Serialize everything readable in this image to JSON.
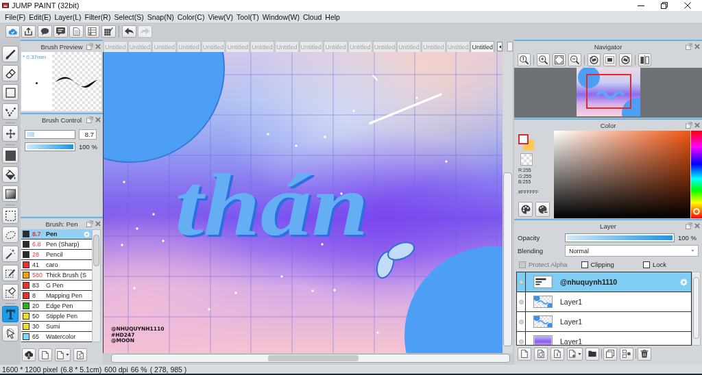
{
  "window": {
    "title": "JUMP PAINT (32bit)"
  },
  "menu": [
    "File(F)",
    "Edit(E)",
    "Layer(L)",
    "Filter(R)",
    "Select(S)",
    "Snap(N)",
    "Color(C)",
    "View(V)",
    "Tool(T)",
    "Window(W)",
    "Cloud",
    "Help"
  ],
  "toolbar_groups": [
    [
      {
        "kind": "cloud",
        "disabled": false
      },
      {
        "kind": "upload",
        "disabled": false
      },
      {
        "kind": "speech",
        "disabled": false
      },
      {
        "kind": "message",
        "disabled": false
      },
      {
        "kind": "document",
        "disabled": false
      },
      {
        "kind": "list",
        "disabled": false
      },
      {
        "kind": "grid_edit",
        "disabled": false
      }
    ],
    [
      {
        "kind": "undo",
        "disabled": false
      },
      {
        "kind": "redo",
        "disabled": true
      }
    ]
  ],
  "tool_groups": [
    [
      {
        "kind": "brush",
        "selected": false
      },
      {
        "kind": "eraser",
        "selected": false
      },
      {
        "kind": "shape",
        "selected": false
      },
      {
        "kind": "polyline",
        "selected": false
      }
    ],
    [
      {
        "kind": "move",
        "selected": false
      }
    ],
    [
      {
        "kind": "fill",
        "selected": false
      },
      {
        "kind": "bucket",
        "selected": false
      },
      {
        "kind": "gradient",
        "selected": false
      }
    ],
    [
      {
        "kind": "select",
        "selected": false
      },
      {
        "kind": "lasso",
        "selected": false
      },
      {
        "kind": "wand",
        "selected": false
      },
      {
        "kind": "select_pen",
        "selected": false
      },
      {
        "kind": "select_eraser",
        "selected": false
      }
    ],
    [
      {
        "kind": "text",
        "selected": true
      },
      {
        "kind": "operation",
        "selected": false
      }
    ]
  ],
  "brush_preview": {
    "title": "Brush Preview",
    "size_label": "* 0.37mm"
  },
  "brush_control": {
    "title": "Brush Control",
    "size": {
      "level": 0.16,
      "value": "8.7"
    },
    "opacity": {
      "level": 1,
      "reading": "100 %"
    }
  },
  "brush_list": {
    "title": "Brush: Pen",
    "items": [
      {
        "color": "#2b2b2b",
        "size": "8.7",
        "size_highlighted": true,
        "name": "Pen",
        "selected": true
      },
      {
        "color": "#2b2b2b",
        "size": "6.8",
        "size_highlighted": true,
        "name": "Pen (Sharp)",
        "selected": false
      },
      {
        "color": "#2b2b2b",
        "size": "28",
        "size_highlighted": true,
        "name": "Pencil",
        "selected": false
      },
      {
        "color": "#e8322e",
        "size": "41",
        "size_highlighted": false,
        "name": "caro",
        "selected": false
      },
      {
        "color": "#f0a010",
        "size": "580",
        "size_highlighted": true,
        "name": "Thick Brush (S",
        "selected": false
      },
      {
        "color": "#e8322e",
        "size": "83",
        "size_highlighted": false,
        "name": "G Pen",
        "selected": false
      },
      {
        "color": "#e8322e",
        "size": "8",
        "size_highlighted": false,
        "name": "Mapping Pen",
        "selected": false
      },
      {
        "color": "#22b422",
        "size": "20",
        "size_highlighted": false,
        "name": "Edge Pen",
        "selected": false
      },
      {
        "color": "#ece024",
        "size": "50",
        "size_highlighted": false,
        "name": "Stipple Pen",
        "selected": false
      },
      {
        "color": "#ece024",
        "size": "30",
        "size_highlighted": false,
        "name": "Sumi",
        "selected": false
      },
      {
        "color": "#7cd8f8",
        "size": "65",
        "size_highlighted": false,
        "name": "Watercolor",
        "selected": false
      }
    ]
  },
  "tabs": [
    {
      "label": "Untitled",
      "selected": false
    },
    {
      "label": "Untitled",
      "selected": false
    },
    {
      "label": "Untitled",
      "selected": false
    },
    {
      "label": "Untitled",
      "selected": false
    },
    {
      "label": "Untitled",
      "selected": false
    },
    {
      "label": "Untitled",
      "selected": false
    },
    {
      "label": "Untitled",
      "selected": false
    },
    {
      "label": "Untitled",
      "selected": false
    },
    {
      "label": "Untitled",
      "selected": false
    },
    {
      "label": "Untitled",
      "selected": false
    },
    {
      "label": "Untitled",
      "selected": false
    },
    {
      "label": "Untitled",
      "selected": false
    },
    {
      "label": "Untitled",
      "selected": false
    },
    {
      "label": "Untitled",
      "selected": false
    },
    {
      "label": "Untitled",
      "selected": false
    },
    {
      "label": "Untitled",
      "selected": true
    }
  ],
  "canvas": {
    "lettering": "thán",
    "credits": [
      "@NHUQUYNH1110",
      "#HD247",
      "@MOON"
    ]
  },
  "navigator": {
    "title": "Navigator"
  },
  "color": {
    "title": "Color",
    "swatches": [
      {
        "kind": "foreground",
        "color": "#ffffff"
      },
      {
        "kind": "background",
        "color": "#ffc65a"
      }
    ],
    "channels": [
      "R:255",
      "G:255",
      "B:255"
    ],
    "hex": "#FFFFFF"
  },
  "layer_panel": {
    "title": "Layer",
    "opacity": {
      "label": "Opacity",
      "level": 1,
      "reading": "100 %"
    },
    "blending": {
      "label": "Blending",
      "value": "Normal"
    },
    "options": [
      {
        "label": "Protect Alpha",
        "checked": false,
        "disabled": true
      },
      {
        "label": "Clipping",
        "checked": false,
        "disabled": false
      },
      {
        "label": "Lock",
        "checked": false,
        "disabled": false
      }
    ],
    "layers": [
      {
        "name": "@nhuquynh1110",
        "kind": "text",
        "selected": true
      },
      {
        "name": "Layer1",
        "kind": "shapes",
        "selected": false
      },
      {
        "name": "Layer1",
        "kind": "shapes",
        "selected": false
      },
      {
        "name": "Layer1",
        "kind": "wash",
        "selected": false
      }
    ]
  },
  "status_bar": [
    "1600 * 1200 pixel",
    "(6.8 * 5.1cm)",
    "600 dpi",
    "66 %",
    "( 278, 985 )"
  ]
}
